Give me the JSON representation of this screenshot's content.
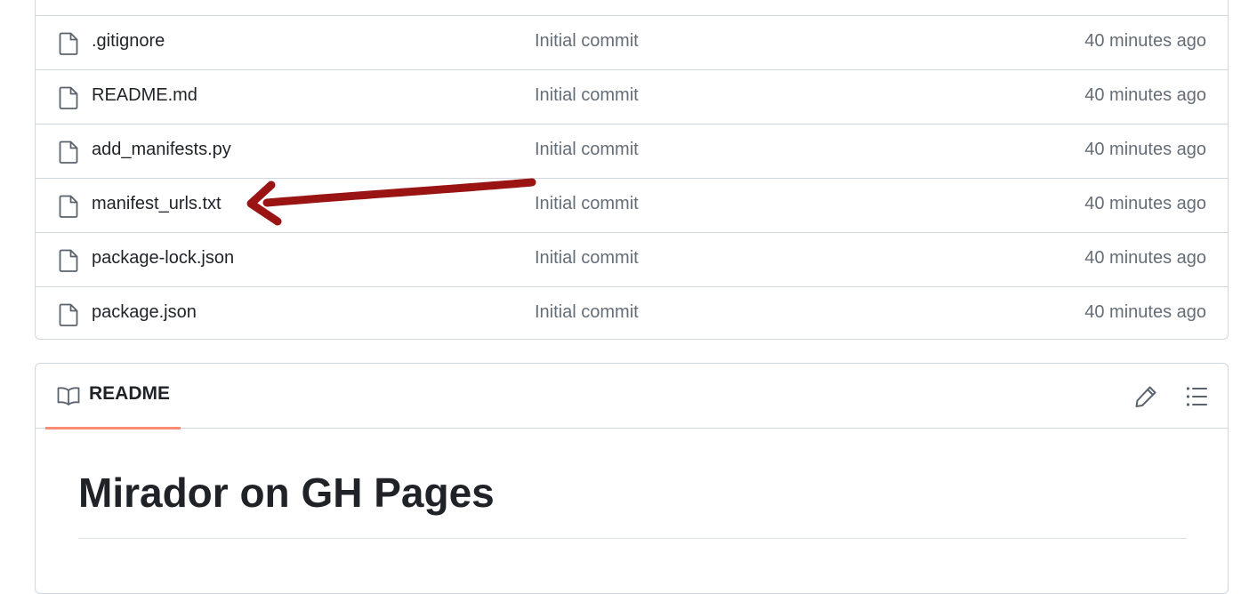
{
  "files": [
    {
      "name": ".gitignore",
      "commit": "Initial commit",
      "time": "40 minutes ago"
    },
    {
      "name": "README.md",
      "commit": "Initial commit",
      "time": "40 minutes ago"
    },
    {
      "name": "add_manifests.py",
      "commit": "Initial commit",
      "time": "40 minutes ago"
    },
    {
      "name": "manifest_urls.txt",
      "commit": "Initial commit",
      "time": "40 minutes ago"
    },
    {
      "name": "package-lock.json",
      "commit": "Initial commit",
      "time": "40 minutes ago"
    },
    {
      "name": "package.json",
      "commit": "Initial commit",
      "time": "40 minutes ago"
    }
  ],
  "readme": {
    "tab_label": "README",
    "title": "Mirador on GH Pages",
    "tab_underline_color": "#fd8c73"
  },
  "icons": {
    "file": "file-icon",
    "book": "book-icon",
    "edit": "pencil-icon",
    "outline": "list-icon"
  },
  "annotation": {
    "color": "#9b1414",
    "points_to": "manifest_urls.txt"
  }
}
